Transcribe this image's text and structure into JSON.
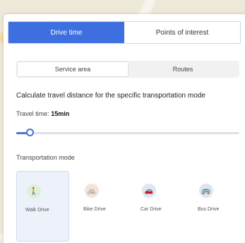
{
  "tabs": [
    {
      "label": "Drive time",
      "active": true
    },
    {
      "label": "Points of interest",
      "active": false
    }
  ],
  "sub_tabs": [
    {
      "label": "Service area",
      "active": true
    },
    {
      "label": "Routes",
      "active": false
    }
  ],
  "description": "Calculate travel distance for the specific transportation mode",
  "travel_time": {
    "label": "Travel time:",
    "value": "15min"
  },
  "slider": {
    "fraction": 0.06
  },
  "modes_label": "Transportation mode",
  "modes": [
    {
      "label": "Walk Drive",
      "icon": "walk-icon",
      "color": "#dff0d8",
      "active": true
    },
    {
      "label": "Bike Drive",
      "icon": "bike-icon",
      "color": "#f6e2d6",
      "active": false
    },
    {
      "label": "Car Drive",
      "icon": "car-icon",
      "color": "#dde6f3",
      "active": false
    },
    {
      "label": "Bus Drive",
      "icon": "bus-icon",
      "color": "#e0e4ec",
      "active": false
    }
  ],
  "colors": {
    "accent": "#3d6fe0",
    "walk": "#9bcc7a",
    "bike": "#e8b89a",
    "car": "#8fa9d6",
    "bus": "#7d8aa6"
  }
}
